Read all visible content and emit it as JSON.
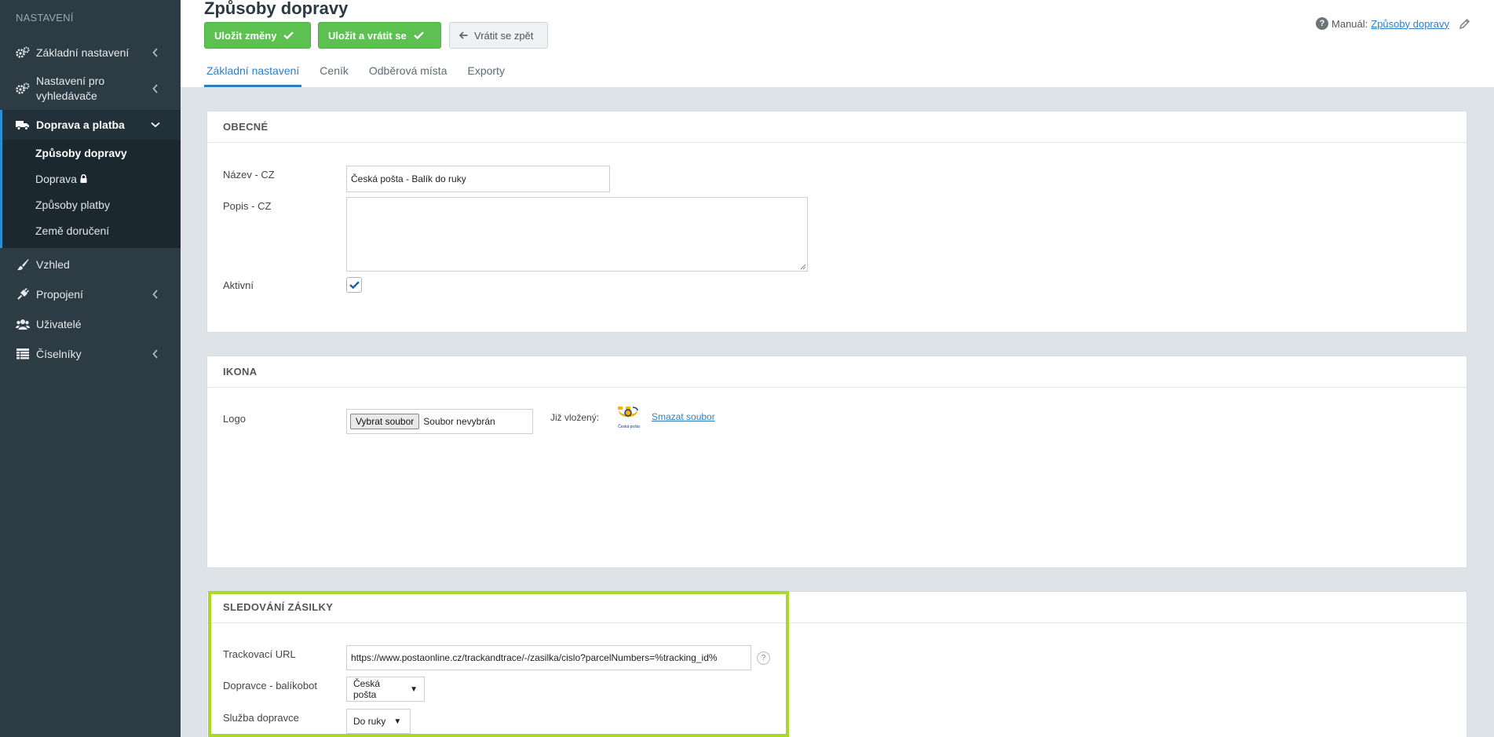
{
  "sidebar": {
    "heading": "NASTAVENÍ",
    "items": [
      {
        "label": "Základní nastavení",
        "icon": "gears-icon"
      },
      {
        "label": "Nastavení pro vyhledávače",
        "icon": "gears-icon"
      },
      {
        "label": "Doprava a platba",
        "icon": "truck-icon"
      },
      {
        "label": "Vzhled",
        "icon": "brush-icon"
      },
      {
        "label": "Propojení",
        "icon": "plug-icon"
      },
      {
        "label": "Uživatelé",
        "icon": "users-icon"
      },
      {
        "label": "Číselníky",
        "icon": "table-icon"
      }
    ],
    "subitems": [
      "Způsoby dopravy",
      "Doprava",
      "Způsoby platby",
      "Země doručení"
    ]
  },
  "header": {
    "title": "Způsoby dopravy",
    "save_label": "Uložit změny",
    "save_return_label": "Uložit a vrátit se",
    "back_label": "Vrátit se zpět",
    "manual_label": "Manuál:",
    "manual_link": "Způsoby dopravy",
    "tabs": [
      "Základní nastavení",
      "Ceník",
      "Odběrová místa",
      "Exporty"
    ]
  },
  "general": {
    "heading": "OBECNÉ",
    "name_label": "Název - CZ",
    "name_value": "Česká pošta - Balík do ruky",
    "desc_label": "Popis - CZ",
    "desc_value": "",
    "active_label": "Aktivní"
  },
  "icon_section": {
    "heading": "IKONA",
    "logo_label": "Logo",
    "file_button": "Vybrat soubor",
    "file_status": "Soubor nevybrán",
    "inserted_label": "Již vložený:",
    "logo_caption": "Česká pošta",
    "delete_link": "Smazat soubor"
  },
  "tracking": {
    "heading": "SLEDOVÁNÍ ZÁSILKY",
    "url_label": "Trackovací URL",
    "url_value": "https://www.postaonline.cz/trackandtrace/-/zasilka/cislo?parcelNumbers=%tracking_id%",
    "help_symbol": "?",
    "carrier_label": "Dopravce - balíkobot",
    "carrier_value": "Česká pošta",
    "service_label": "Služba dopravce",
    "service_value": "Do ruky"
  },
  "colors": {
    "accent": "#2d7fc1",
    "green": "#5cc151",
    "highlight": "#a8d92a",
    "sidebar": "#2c3b44"
  }
}
